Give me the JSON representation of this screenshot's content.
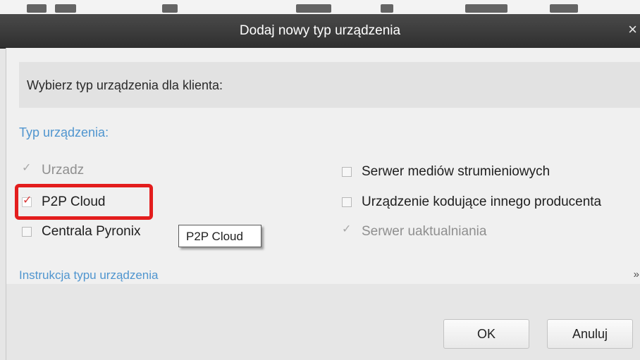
{
  "dialog": {
    "title": "Dodaj nowy typ urządzenia",
    "close_glyph": "×",
    "prompt": "Wybierz typ urządzenia dla klienta:",
    "section_label": "Typ urządzenia:",
    "options_left": [
      {
        "label": "Urzadz",
        "checked": true,
        "enabled": false
      },
      {
        "label": "P2P Cloud",
        "checked": true,
        "enabled": true
      },
      {
        "label": "Centrala Pyronix",
        "checked": false,
        "enabled": true
      }
    ],
    "options_right": [
      {
        "label": "Serwer mediów strumieniowych",
        "checked": false,
        "enabled": true
      },
      {
        "label": "Urządzenie kodujące innego producenta",
        "checked": false,
        "enabled": true
      },
      {
        "label": "Serwer uaktualniania",
        "checked": true,
        "enabled": false
      }
    ],
    "tooltip": "P2P Cloud",
    "instructions_label": "Instrukcja typu urządzenia",
    "instructions_chevron": "»",
    "buttons": {
      "ok": "OK",
      "cancel": "Anuluj"
    }
  },
  "icons": {
    "check": "checkmark-icon",
    "close": "close-icon",
    "expand": "double-chevron-down-icon"
  },
  "colors": {
    "titlebar": "#3a3a3a",
    "section_accent": "#4f95cf",
    "highlight": "#e31d1d",
    "check_red": "#d93838"
  }
}
